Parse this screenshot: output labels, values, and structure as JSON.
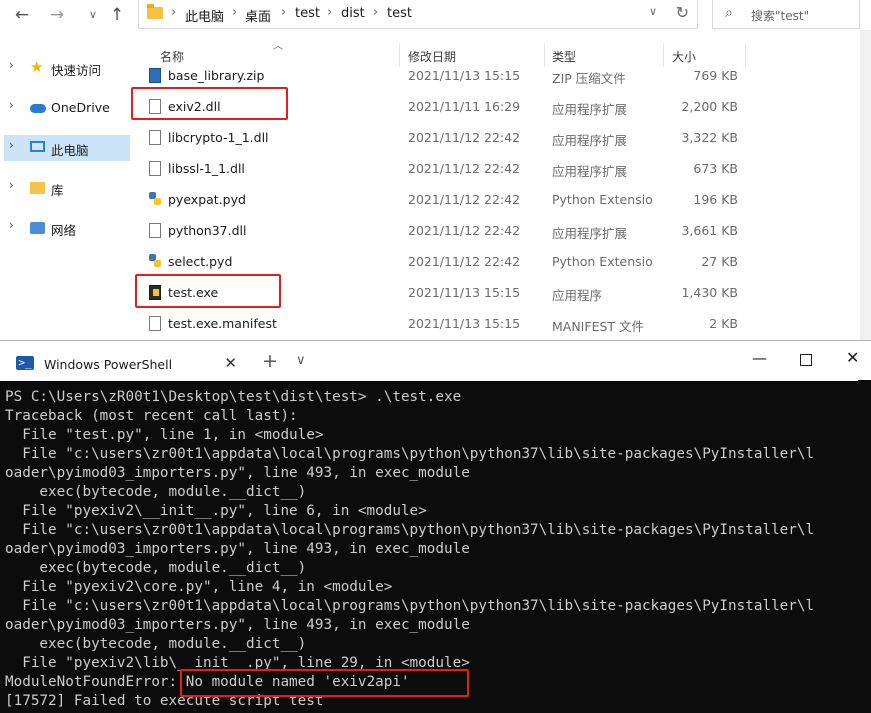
{
  "explorer": {
    "address": {
      "breadcrumbs": [
        "此电脑",
        "桌面",
        "test",
        "dist",
        "test"
      ]
    },
    "search": {
      "placeholder": "搜索\"test\""
    },
    "nav_tree": [
      {
        "label": "快速访问",
        "icon": "star-icon"
      },
      {
        "label": "OneDrive",
        "icon": "cloud-icon"
      },
      {
        "label": "此电脑",
        "icon": "computer-icon",
        "selected": true
      },
      {
        "label": "库",
        "icon": "library-folder-icon"
      },
      {
        "label": "网络",
        "icon": "network-icon"
      }
    ],
    "columns": {
      "name": "名称",
      "date": "修改日期",
      "type": "类型",
      "size": "大小"
    },
    "files": [
      {
        "name": "base_library.zip",
        "date": "2021/11/13 15:15",
        "type": "ZIP 压缩文件",
        "size": "769 KB",
        "icon": "zip-file-icon",
        "highlighted": false
      },
      {
        "name": "exiv2.dll",
        "date": "2021/11/11 16:29",
        "type": "应用程序扩展",
        "size": "2,200 KB",
        "icon": "dll-file-icon",
        "highlighted": true
      },
      {
        "name": "libcrypto-1_1.dll",
        "date": "2021/11/12 22:42",
        "type": "应用程序扩展",
        "size": "3,322 KB",
        "icon": "dll-file-icon",
        "highlighted": false
      },
      {
        "name": "libssl-1_1.dll",
        "date": "2021/11/12 22:42",
        "type": "应用程序扩展",
        "size": "673 KB",
        "icon": "dll-file-icon",
        "highlighted": false
      },
      {
        "name": "pyexpat.pyd",
        "date": "2021/11/12 22:42",
        "type": "Python Extensio...",
        "size": "196 KB",
        "icon": "python-file-icon",
        "highlighted": false
      },
      {
        "name": "python37.dll",
        "date": "2021/11/12 22:42",
        "type": "应用程序扩展",
        "size": "3,661 KB",
        "icon": "dll-file-icon",
        "highlighted": false
      },
      {
        "name": "select.pyd",
        "date": "2021/11/12 22:42",
        "type": "Python Extensio...",
        "size": "27 KB",
        "icon": "python-file-icon",
        "highlighted": false
      },
      {
        "name": "test.exe",
        "date": "2021/11/13 15:15",
        "type": "应用程序",
        "size": "1,430 KB",
        "icon": "exe-file-icon",
        "highlighted": true
      },
      {
        "name": "test.exe.manifest",
        "date": "2021/11/13 15:15",
        "type": "MANIFEST 文件",
        "size": "2 KB",
        "icon": "manifest-file-icon",
        "highlighted": false
      }
    ]
  },
  "powershell": {
    "tab_label": "Windows PowerShell",
    "tab_icon_glyph": ">_",
    "new_tab_glyph": "+",
    "close_glyph": "✕",
    "lines": [
      "PS C:\\Users\\zR00t1\\Desktop\\test\\dist\\test> .\\test.exe",
      "Traceback (most recent call last):",
      "  File \"test.py\", line 1, in <module>",
      "  File \"c:\\users\\zr00t1\\appdata\\local\\programs\\python\\python37\\lib\\site-packages\\PyInstaller\\l",
      "oader\\pyimod03_importers.py\", line 493, in exec_module",
      "    exec(bytecode, module.__dict__)",
      "  File \"pyexiv2\\__init__.py\", line 6, in <module>",
      "  File \"c:\\users\\zr00t1\\appdata\\local\\programs\\python\\python37\\lib\\site-packages\\PyInstaller\\l",
      "oader\\pyimod03_importers.py\", line 493, in exec_module",
      "    exec(bytecode, module.__dict__)",
      "  File \"pyexiv2\\core.py\", line 4, in <module>",
      "  File \"c:\\users\\zr00t1\\appdata\\local\\programs\\python\\python37\\lib\\site-packages\\PyInstaller\\l",
      "oader\\pyimod03_importers.py\", line 493, in exec_module",
      "    exec(bytecode, module.__dict__)",
      "  File \"pyexiv2\\lib\\__init__.py\", line 29, in <module>",
      "ModuleNotFoundError: No module named 'exiv2api'",
      "[17572] Failed to execute script test"
    ]
  },
  "colors": {
    "highlight_box": "#e02020",
    "selected_nav": "#cce4f7",
    "console_bg": "#0c0c0c",
    "console_fg": "#cccccc"
  }
}
